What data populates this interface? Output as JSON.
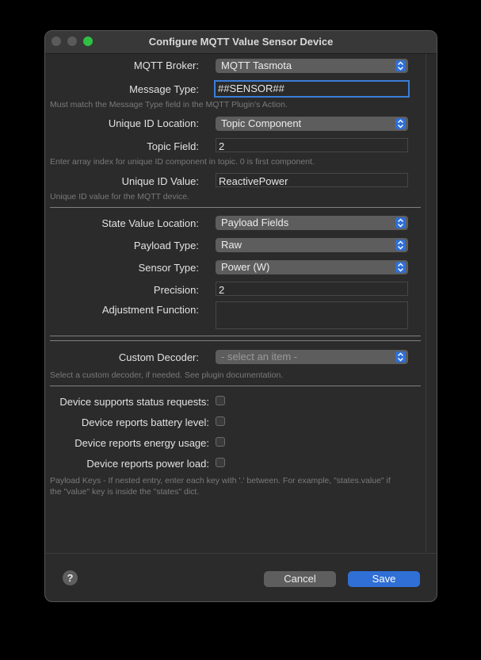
{
  "window": {
    "title": "Configure MQTT Value Sensor Device"
  },
  "fields": {
    "broker": {
      "label": "MQTT Broker:",
      "value": "MQTT Tasmota"
    },
    "message_type": {
      "label": "Message Type:",
      "value": "##SENSOR##",
      "hint": "Must match the Message Type field in the MQTT Plugin's Action."
    },
    "unique_id_location": {
      "label": "Unique ID Location:",
      "value": "Topic Component"
    },
    "topic_field": {
      "label": "Topic Field:",
      "value": "2",
      "hint": "Enter array index for unique ID component in topic.  0 is first component."
    },
    "unique_id_value": {
      "label": "Unique ID Value:",
      "value": "ReactivePower",
      "hint": "Unique ID value for the MQTT device."
    },
    "state_value_location": {
      "label": "State Value Location:",
      "value": "Payload Fields"
    },
    "payload_type": {
      "label": "Payload Type:",
      "value": "Raw"
    },
    "sensor_type": {
      "label": "Sensor Type:",
      "value": "Power (W)"
    },
    "precision": {
      "label": "Precision:",
      "value": "2"
    },
    "adjustment_function": {
      "label": "Adjustment Function:",
      "value": ""
    },
    "custom_decoder": {
      "label": "Custom Decoder:",
      "value": "- select an item -",
      "hint": "Select a custom decoder, if needed.  See plugin documentation."
    }
  },
  "checkboxes": [
    {
      "label": "Device supports status requests:",
      "checked": false
    },
    {
      "label": "Device reports battery level:",
      "checked": false
    },
    {
      "label": "Device reports energy usage:",
      "checked": false
    },
    {
      "label": "Device reports power load:",
      "checked": false
    }
  ],
  "payload_keys_hint": "Payload Keys - If nested entry, enter each key with '.' between.  For example, \"states.value\" if the \"value\" key is inside the \"states\" dict.",
  "buttons": {
    "help": "?",
    "cancel": "Cancel",
    "save": "Save"
  },
  "colors": {
    "accent": "#2f6fd6",
    "background": "#2b2b2b",
    "zoom_light": "#2fc043"
  }
}
